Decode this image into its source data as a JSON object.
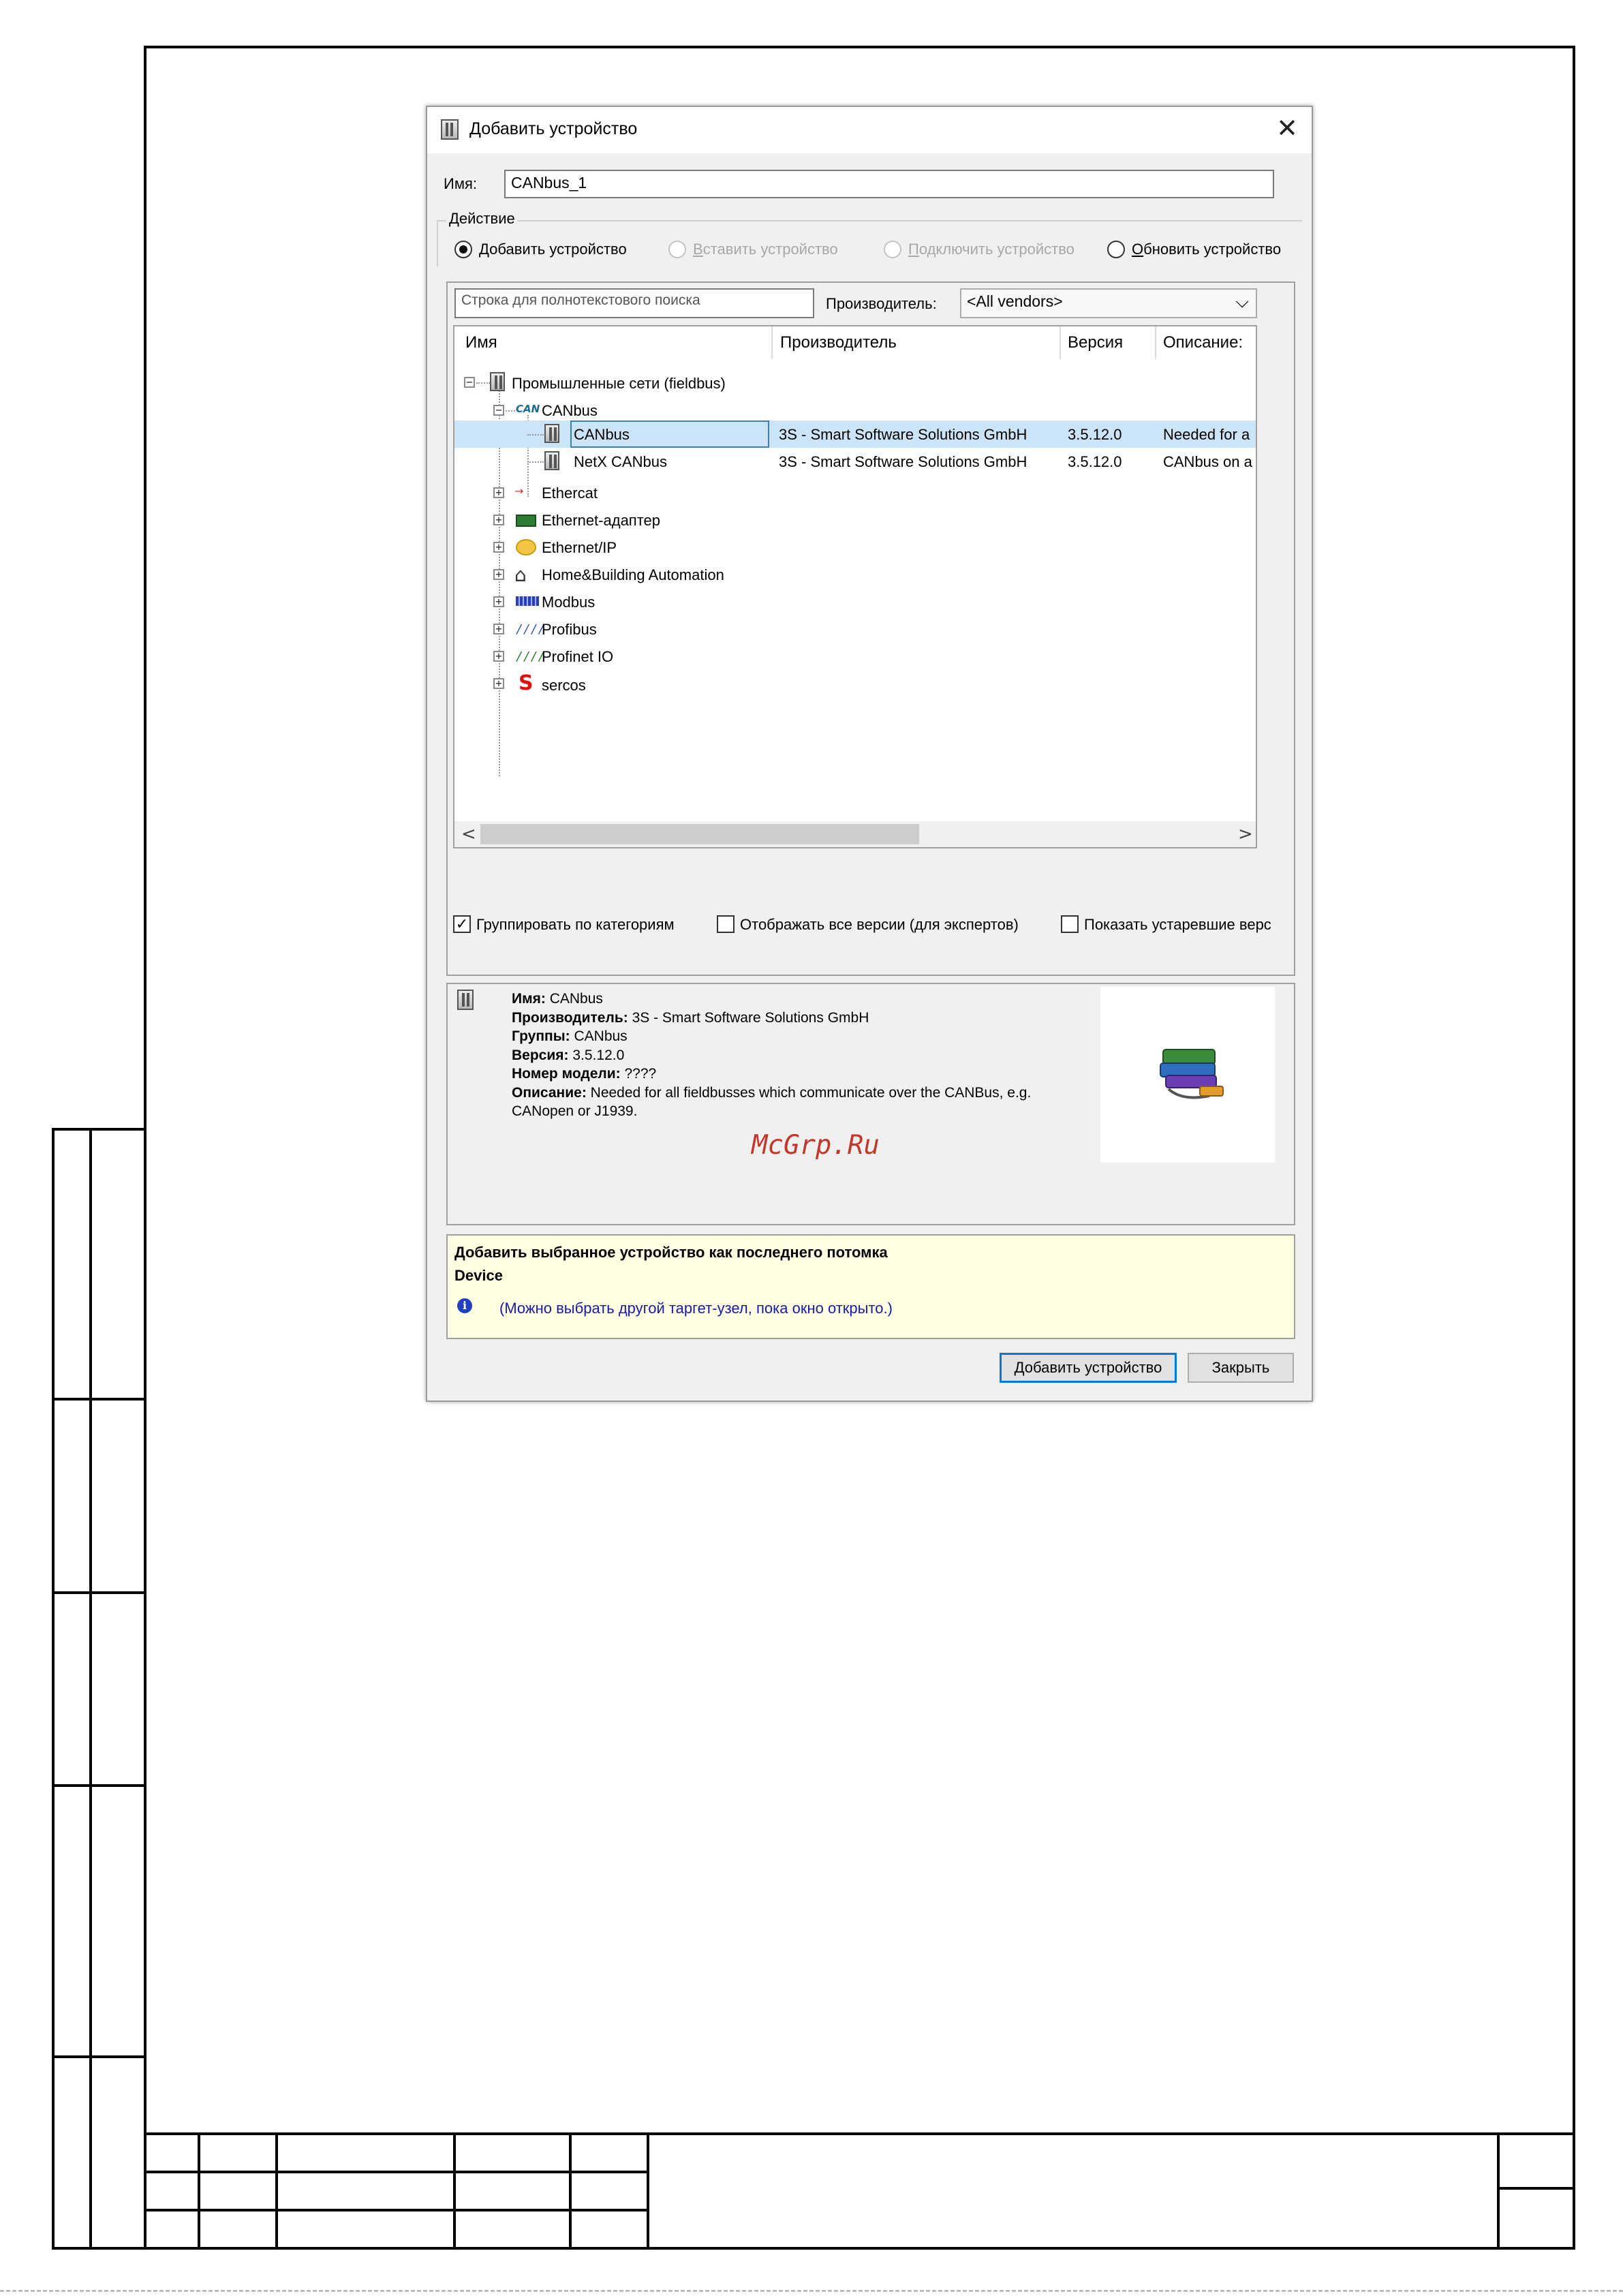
{
  "dialog": {
    "title": "Добавить устройство",
    "close_glyph": "✕",
    "name_label": "Имя:",
    "name_value": "CANbus_1",
    "action_group_label": "Действие",
    "actions": [
      {
        "prefix": "",
        "accel": "Д",
        "rest": "обавить устройство",
        "state": "checked"
      },
      {
        "prefix": "",
        "accel": "В",
        "rest": "ставить устройство",
        "state": "disabled"
      },
      {
        "prefix": "",
        "accel": "П",
        "rest": "одключить устройство",
        "state": "disabled"
      },
      {
        "prefix": "",
        "accel": "О",
        "rest": "бновить устройство",
        "state": "unchecked"
      }
    ],
    "search_placeholder": "Строка для полнотекстового поиска",
    "vendor_label": "Производитель:",
    "vendor_value": "<All vendors>",
    "columns": [
      "Имя",
      "Производитель",
      "Версия",
      "Описание:"
    ],
    "tree": {
      "root": "Промышленные сети (fieldbus)",
      "canbus_group": "CANbus",
      "can_logo_text": "CAN",
      "rows": [
        {
          "name": "CANbus",
          "vendor": "3S - Smart Software Solutions GmbH",
          "version": "3.5.12.0",
          "desc": "Needed for a"
        },
        {
          "name": "NetX CANbus",
          "vendor": "3S - Smart Software Solutions GmbH",
          "version": "3.5.12.0",
          "desc": "CANbus on a"
        }
      ],
      "categories": [
        "Ethercat",
        "Ethernet-адаптер",
        "Ethernet/IP",
        "Home&Building Automation",
        "Modbus",
        "Profibus",
        "Profinet IO",
        "sercos"
      ]
    },
    "scroll_left": "<",
    "scroll_right": ">",
    "checkboxes": [
      {
        "label": "Группировать по категориям",
        "checked": true
      },
      {
        "label": "Отображать все версии (для экспертов)",
        "checked": false
      },
      {
        "label": "Показать устаревшие верс",
        "checked": false
      }
    ],
    "check_glyph": "✓",
    "info": {
      "name_label": "Имя:",
      "name_value": "CANbus",
      "vendor_label": "Производитель:",
      "vendor_value": "3S - Smart Software Solutions GmbH",
      "groups_label": "Группы:",
      "groups_value": "CANbus",
      "version_label": "Версия:",
      "version_value": "3.5.12.0",
      "model_label": "Номер модели:",
      "model_value": "????",
      "desc_label": "Описание:",
      "desc_line1": "Needed for all fieldbusses which communicate over the CANBus, e.g.",
      "desc_line2": "CANopen or J1939."
    },
    "watermark": "McGrp.Ru",
    "hint_line1": "Добавить выбранное устройство как последнего потомка",
    "hint_line2": "Device",
    "hint_note": "(Можно выбрать другой таргет-узел, пока окно открыто.)",
    "info_glyph": "i",
    "add_button": "Добавить устройство",
    "close_button": "Закрыть"
  },
  "colors": {
    "accent": "#0078d7",
    "selection": "#cce4f7",
    "hint_bg": "#ffffe1",
    "watermark": "#c0392b",
    "note_text": "#1a1aa6"
  }
}
